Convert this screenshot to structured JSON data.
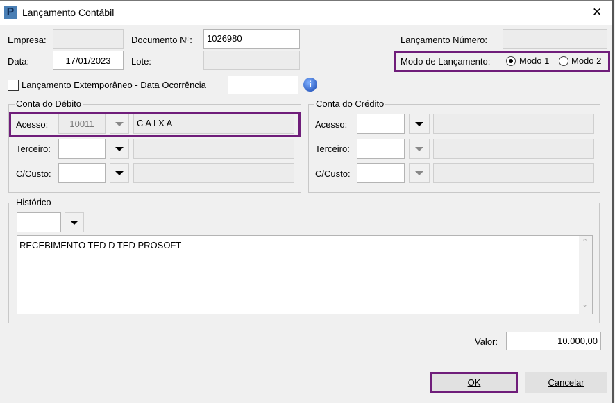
{
  "window": {
    "title": "Lançamento Contábil",
    "close": "✕"
  },
  "fields": {
    "empresa_label": "Empresa:",
    "empresa_value": "",
    "documento_label": "Documento Nº:",
    "documento_value": "1026980",
    "data_label": "Data:",
    "data_value": "17/01/2023",
    "lote_label": "Lote:",
    "lote_value": "",
    "lancamento_numero_label": "Lançamento Número:",
    "lancamento_numero_value": "",
    "modo_label": "Modo de Lançamento:",
    "modo1": "Modo 1",
    "modo2": "Modo 2",
    "modo_selected": "Modo 1",
    "extemporaneo_label": "Lançamento Extemporâneo - Data Ocorrência",
    "extemporaneo_checked": false,
    "data_ocorrencia": ""
  },
  "debito": {
    "title": "Conta do Débito",
    "acesso_label": "Acesso:",
    "acesso_value": "10011",
    "acesso_desc": "C A I X A",
    "terceiro_label": "Terceiro:",
    "custo_label": "C/Custo:"
  },
  "credito": {
    "title": "Conta do Crédito",
    "acesso_label": "Acesso:",
    "terceiro_label": "Terceiro:",
    "custo_label": "C/Custo:"
  },
  "historico": {
    "title": "Histórico",
    "text": "RECEBIMENTO TED D TED PROSOFT"
  },
  "valor": {
    "label": "Valor:",
    "value": "10.000,00"
  },
  "buttons": {
    "ok": "OK",
    "cancel": "Cancelar"
  },
  "colors": {
    "highlight": "#6f1d7a"
  }
}
